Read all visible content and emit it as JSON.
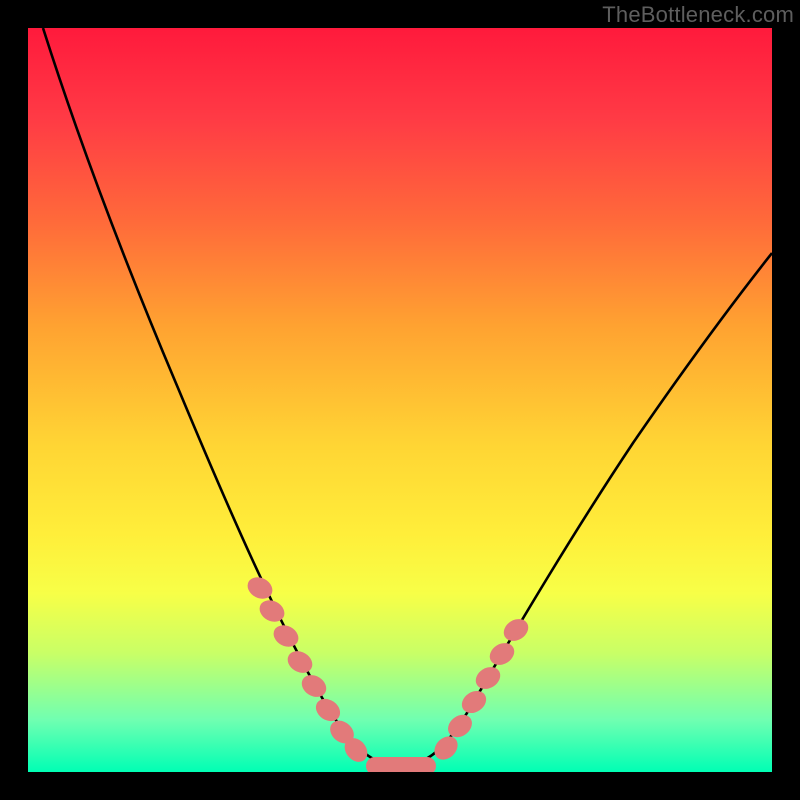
{
  "watermark": "TheBottleneck.com",
  "chart_data": {
    "type": "line",
    "title": "",
    "xlabel": "",
    "ylabel": "",
    "xlim": [
      0,
      100
    ],
    "ylim": [
      0,
      100
    ],
    "grid": false,
    "legend": false,
    "series": [
      {
        "name": "bottleneck-curve",
        "x": [
          2,
          6,
          10,
          14,
          18,
          22,
          26,
          30,
          34,
          38,
          42,
          44,
          46,
          48,
          50,
          52,
          54,
          56,
          58,
          60,
          64,
          70,
          78,
          86,
          94,
          100
        ],
        "y": [
          100,
          86,
          73,
          62,
          52,
          43,
          35,
          28,
          21,
          15,
          9,
          6,
          3,
          1.5,
          1,
          1,
          1.5,
          3,
          6,
          9,
          15,
          24,
          35,
          46,
          56,
          63
        ]
      },
      {
        "name": "highlight-band-left",
        "x": [
          30,
          32,
          34,
          36,
          38,
          40,
          42
        ],
        "y": [
          28,
          24,
          20,
          16,
          13,
          10,
          7
        ]
      },
      {
        "name": "highlight-band-right",
        "x": [
          56,
          58,
          60,
          62,
          64
        ],
        "y": [
          6,
          9,
          12,
          16,
          20
        ]
      },
      {
        "name": "highlight-band-bottom",
        "x": [
          44,
          46,
          48,
          50,
          52,
          54
        ],
        "y": [
          2,
          1.5,
          1,
          1,
          1.5,
          2
        ]
      }
    ],
    "background_gradient": {
      "stops": [
        {
          "pos": 0.0,
          "color": "#ff1a3c"
        },
        {
          "pos": 0.12,
          "color": "#ff3a45"
        },
        {
          "pos": 0.26,
          "color": "#ff6a3a"
        },
        {
          "pos": 0.4,
          "color": "#ffa231"
        },
        {
          "pos": 0.56,
          "color": "#ffd534"
        },
        {
          "pos": 0.68,
          "color": "#ffee3a"
        },
        {
          "pos": 0.76,
          "color": "#f7ff47"
        },
        {
          "pos": 0.84,
          "color": "#c9ff66"
        },
        {
          "pos": 0.93,
          "color": "#70ffb1"
        },
        {
          "pos": 1.0,
          "color": "#00ffb4"
        }
      ]
    },
    "colors": {
      "curve": "#000000",
      "highlight": "#e27a7a",
      "frame": "#000000"
    }
  }
}
